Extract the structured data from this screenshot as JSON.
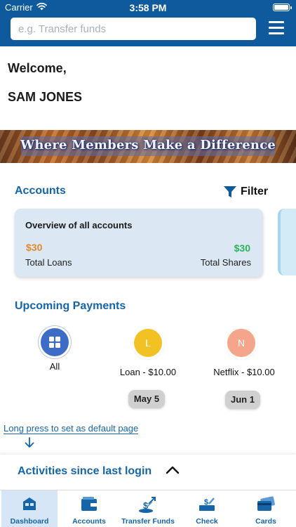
{
  "status_bar": {
    "carrier": "Carrier",
    "time": "3:58 PM"
  },
  "search": {
    "placeholder": "e.g. Transfer funds"
  },
  "greeting": {
    "welcome": "Welcome,",
    "name": "SAM JONES"
  },
  "banner": {
    "text": "Where Members Make a Difference"
  },
  "accounts": {
    "title": "Accounts",
    "filter_label": "Filter",
    "overview_title": "Overview of all accounts",
    "total_loans_value": "$30",
    "total_loans_label": "Total Loans",
    "total_shares_value": "$30",
    "total_shares_label": "Total Shares"
  },
  "upcoming": {
    "title": "Upcoming Payments",
    "items": [
      {
        "label": "All",
        "initial": ""
      },
      {
        "label": "Loan - $10.00",
        "initial": "L",
        "date": "May 5"
      },
      {
        "label": "Netflix - $10.00",
        "initial": "N",
        "date": "Jun 1"
      }
    ]
  },
  "default_page_link": "Long press to set as default page",
  "activities": {
    "title": "Activities since last login"
  },
  "tabs": [
    {
      "label": "Dashboard",
      "icon": "dashboard-icon",
      "active": true
    },
    {
      "label": "Accounts",
      "icon": "wallet-icon"
    },
    {
      "label": "Transfer Funds",
      "icon": "transfer-funds-icon"
    },
    {
      "label": "Check",
      "icon": "check-deposit-icon"
    },
    {
      "label": "Cards",
      "icon": "cards-icon"
    }
  ],
  "colors": {
    "brand": "#0e5a9c",
    "accent": "#1565a8",
    "loans": "#e08a2c",
    "shares": "#2bb35a"
  }
}
